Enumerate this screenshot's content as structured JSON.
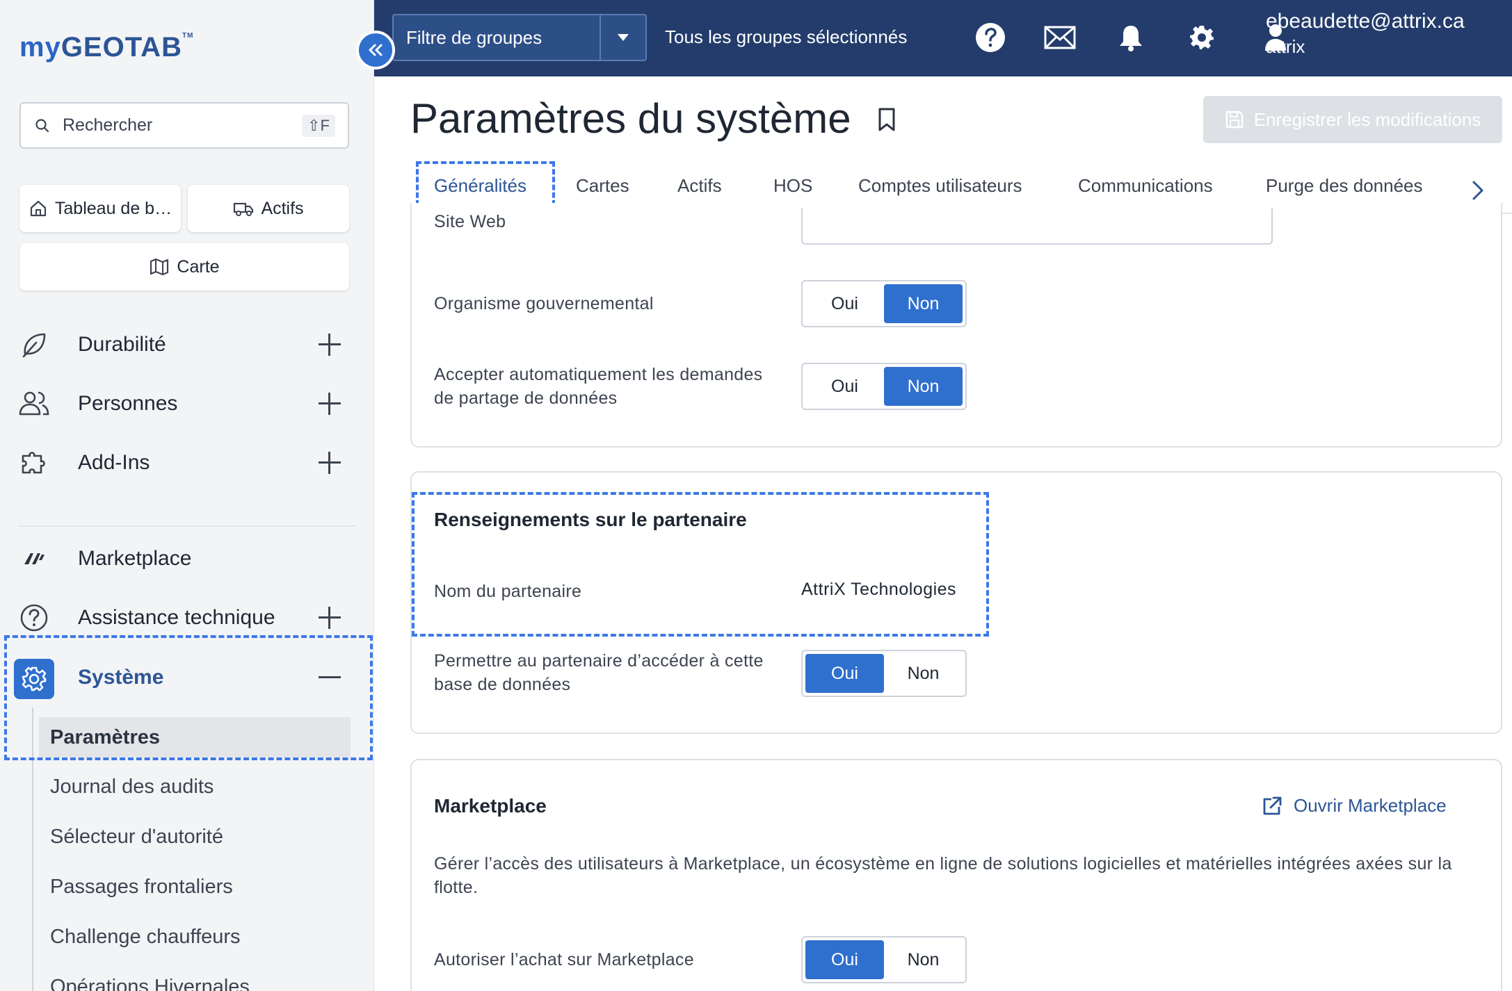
{
  "app": {
    "logo": "myGEOTAB",
    "logo_tm": "TM"
  },
  "colors": {
    "accent": "#2f6fce",
    "topbar": "#233c6b",
    "highlight_dash": "#3b78e7"
  },
  "sidebar": {
    "search_placeholder": "Rechercher",
    "search_shortcut": "⇧F",
    "quick": {
      "dashboard": "Tableau de b…",
      "assets": "Actifs",
      "map": "Carte"
    },
    "nav": [
      {
        "label": "Durabilité",
        "icon": "leaf-icon"
      },
      {
        "label": "Personnes",
        "icon": "people-icon"
      },
      {
        "label": "Add-Ins",
        "icon": "puzzle-icon"
      },
      {
        "label": "Marketplace",
        "icon": "marketplace-icon"
      },
      {
        "label": "Assistance technique",
        "icon": "help-icon"
      },
      {
        "label": "Système",
        "icon": "gear-icon"
      }
    ],
    "system_sub": [
      "Paramètres",
      "Journal des audits",
      "Sélecteur d'autorité",
      "Passages frontaliers",
      "Challenge chauffeurs",
      "Opérations Hivernales"
    ]
  },
  "topbar": {
    "group_filter_label": "Filtre de groupes",
    "groups_text": "Tous les groupes sélectionnés",
    "user_email": "ebeaudette@attrix.ca",
    "user_org": "attrix"
  },
  "page": {
    "title": "Paramètres du système",
    "save_label": "Enregistrer les modifications",
    "tabs": [
      "Généralités",
      "Cartes",
      "Actifs",
      "HOS",
      "Comptes utilisateurs",
      "Communications",
      "Purge des données"
    ]
  },
  "general": {
    "website_label": "Site Web",
    "gov_label": "Organisme gouvernemental",
    "auto_accept_label_1": "Accepter automatiquement les demandes",
    "auto_accept_label_2": "de partage de données"
  },
  "toggle": {
    "yes": "Oui",
    "no": "Non"
  },
  "partner": {
    "title": "Renseignements sur le partenaire",
    "name_label": "Nom du partenaire",
    "name_value": "AttriX Technologies",
    "access_label_1": "Permettre au partenaire d’accéder à cette",
    "access_label_2": "base de données"
  },
  "marketplace": {
    "title": "Marketplace",
    "open_link": "Ouvrir Marketplace",
    "description": "Gérer l’accès des utilisateurs à Marketplace, un écosystème en ligne de solutions logicielles et matérielles intégrées axées sur la flotte.",
    "purchase_label": "Autoriser l’achat sur Marketplace"
  },
  "states": {
    "gov_selected": "Non",
    "auto_accept_selected": "Non",
    "partner_access_selected": "Oui",
    "purchase_selected": "Oui"
  }
}
